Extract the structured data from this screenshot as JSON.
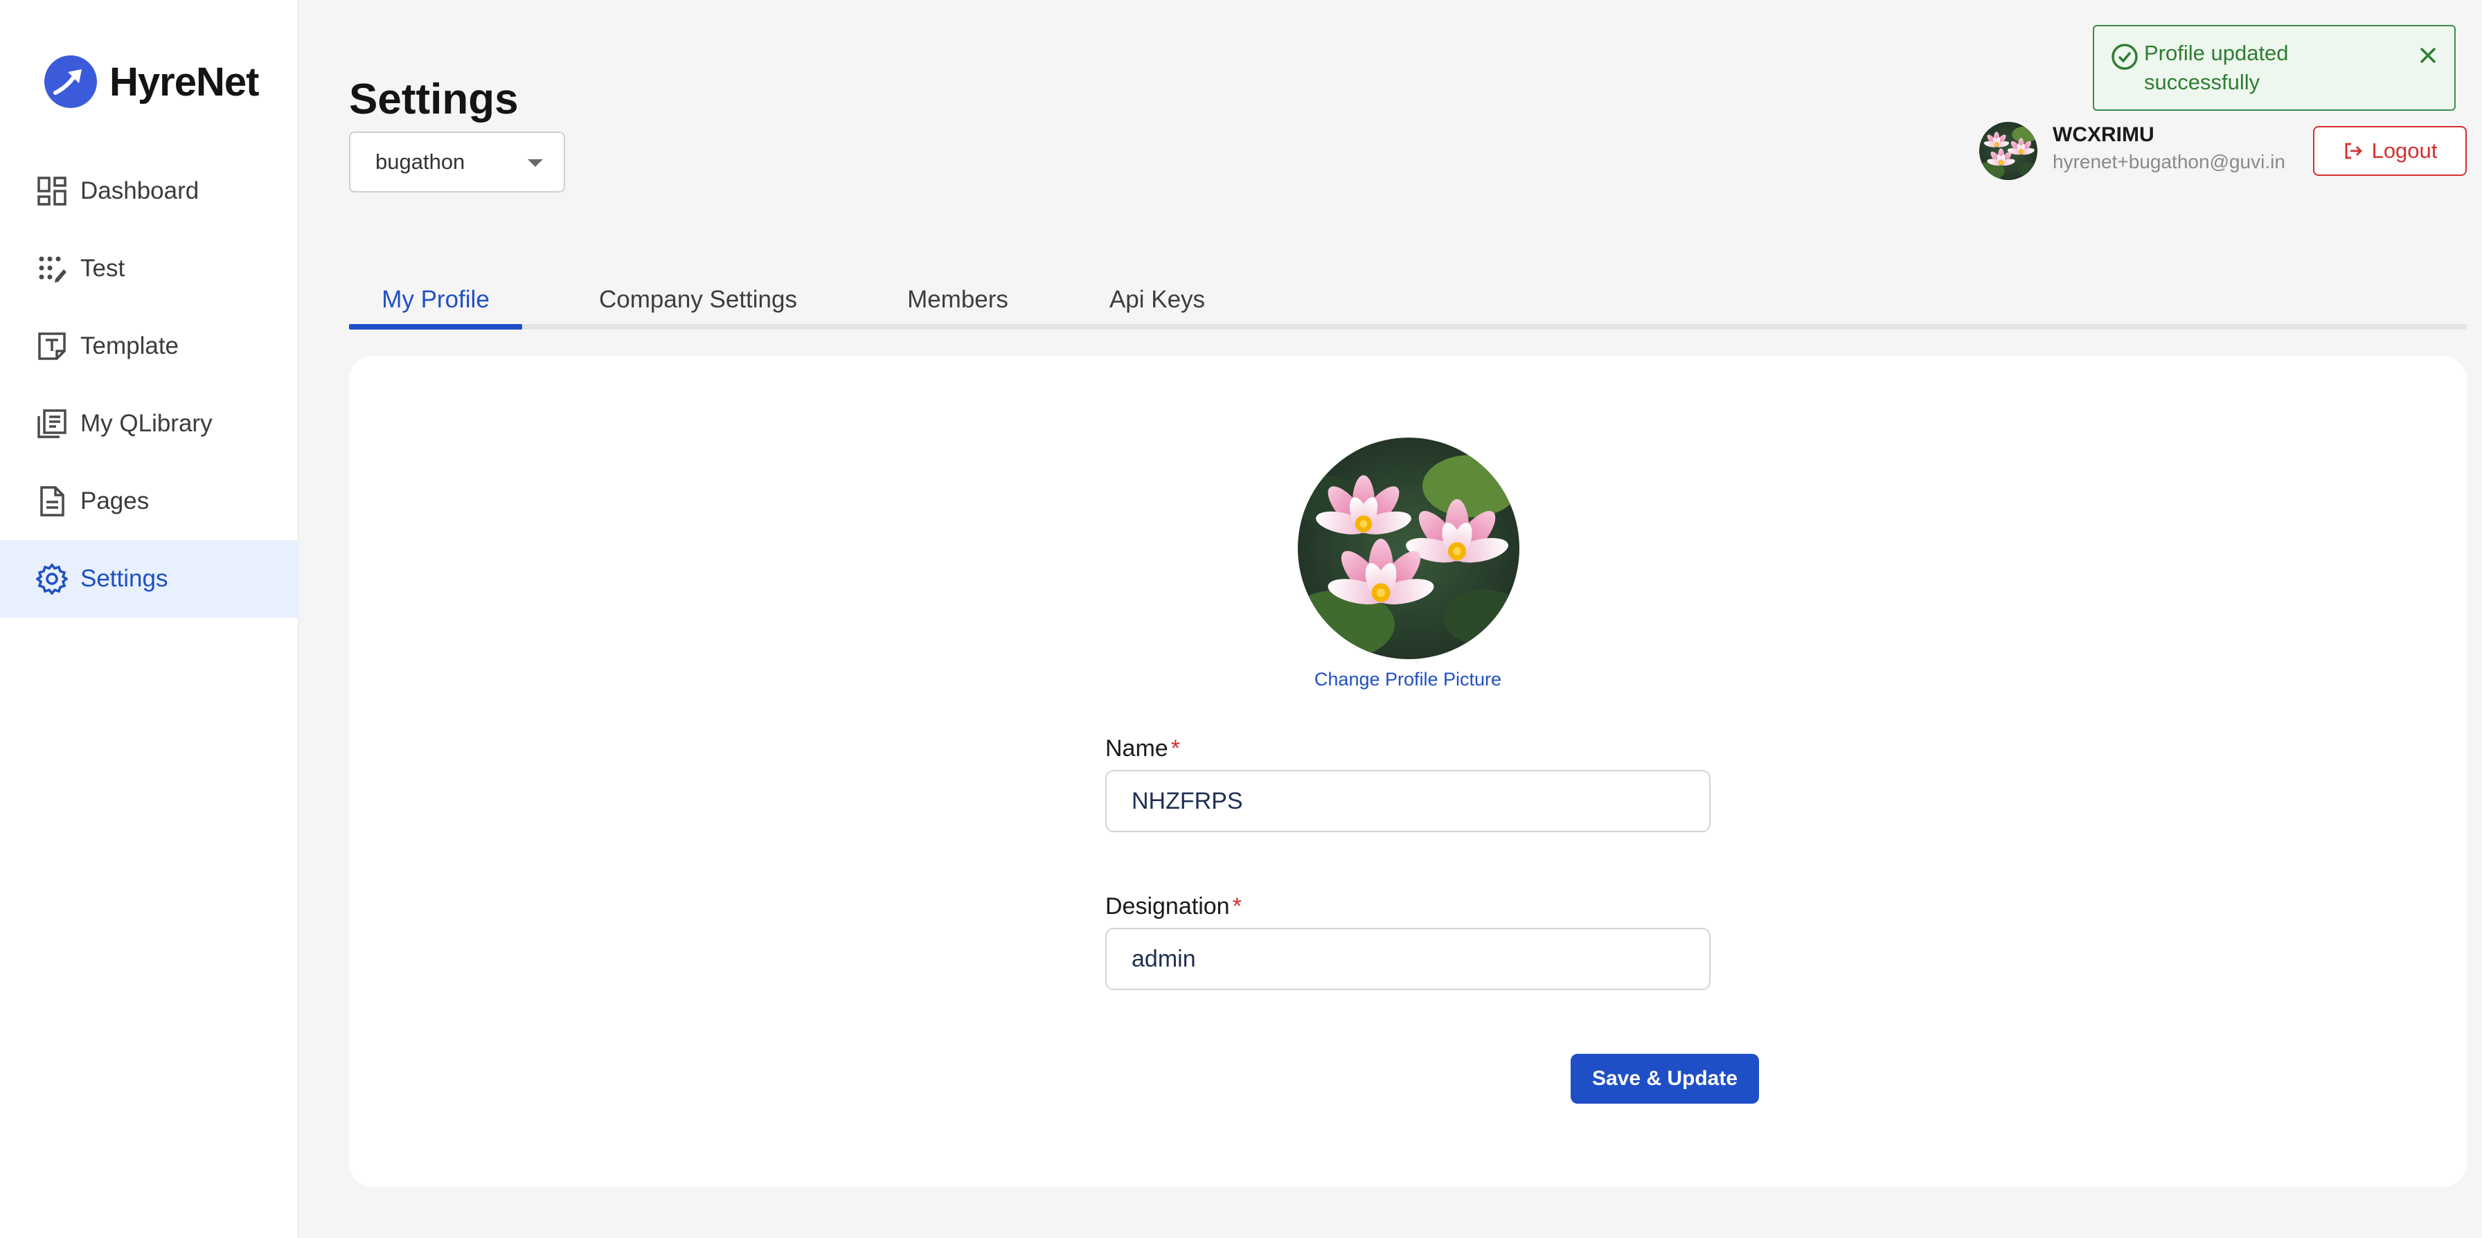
{
  "brand": {
    "name": "HyreNet",
    "logo_icon": "hyrenet-logo-icon",
    "accent": "#3b5bdb"
  },
  "sidebar": {
    "items": [
      {
        "label": "Dashboard",
        "icon": "dashboard-icon",
        "active": false
      },
      {
        "label": "Test",
        "icon": "test-icon",
        "active": false
      },
      {
        "label": "Template",
        "icon": "template-icon",
        "active": false
      },
      {
        "label": "My QLibrary",
        "icon": "qlibrary-icon",
        "active": false
      },
      {
        "label": "Pages",
        "icon": "pages-icon",
        "active": false
      },
      {
        "label": "Settings",
        "icon": "gear-icon",
        "active": true
      }
    ]
  },
  "header": {
    "title": "Settings",
    "org_select": {
      "value": "bugathon"
    }
  },
  "toast": {
    "message": "Profile updated successfully",
    "type": "success",
    "icon": "check-circle-icon",
    "color": "#2e7d32"
  },
  "user": {
    "name": "WCXRIMU",
    "email": "hyrenet+bugathon@guvi.in",
    "avatar": "water-lily-image",
    "logout_label": "Logout"
  },
  "tabs": [
    {
      "label": "My Profile",
      "active": true
    },
    {
      "label": "Company Settings",
      "active": false
    },
    {
      "label": "Members",
      "active": false
    },
    {
      "label": "Api Keys",
      "active": false
    }
  ],
  "profile": {
    "picture": "water-lily-image",
    "change_picture_label": "Change Profile Picture",
    "name_label": "Name",
    "name_value": "NHZFRPS",
    "designation_label": "Designation",
    "designation_value": "admin",
    "required_marker": "*",
    "save_label": "Save & Update"
  },
  "colors": {
    "primary": "#1f4fc6",
    "active_bg": "#e8f0fd",
    "danger": "#d32f2f",
    "success": "#2e7d32"
  }
}
